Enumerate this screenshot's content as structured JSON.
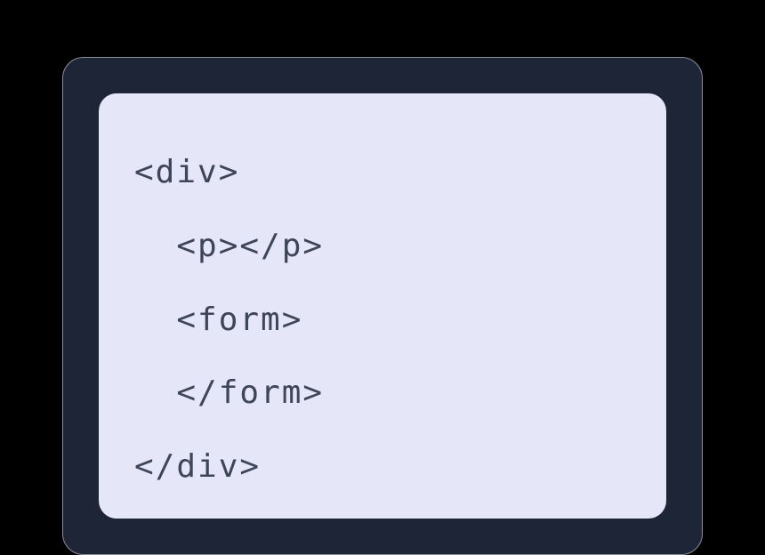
{
  "code": {
    "line1": "<div>",
    "line2": "  <p></p>",
    "line3": "  <form>",
    "line4": "  </form>",
    "line5": "</div>"
  }
}
